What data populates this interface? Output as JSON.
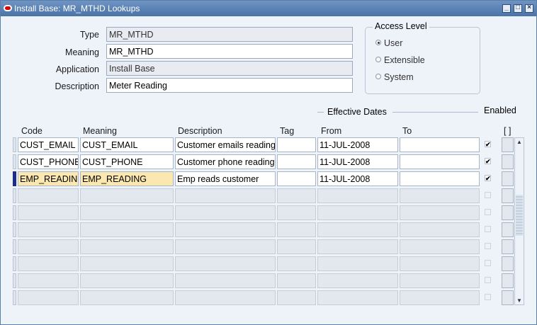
{
  "window": {
    "title": "Install Base: MR_MTHD Lookups",
    "controls": [
      "minimize-icon",
      "maximize-icon",
      "close-icon"
    ]
  },
  "form": {
    "type_label": "Type",
    "type_value": "MR_MTHD",
    "meaning_label": "Meaning",
    "meaning_value": "MR_MTHD",
    "application_label": "Application",
    "application_value": "Install Base",
    "description_label": "Description",
    "description_value": "Meter Reading"
  },
  "access_level": {
    "title": "Access Level",
    "options": [
      "User",
      "Extensible",
      "System"
    ],
    "selected": "User"
  },
  "table": {
    "effective_dates_label": "Effective Dates",
    "enabled_label": "Enabled",
    "flex_label": "[ ]",
    "headers": {
      "code": "Code",
      "meaning": "Meaning",
      "description": "Description",
      "tag": "Tag",
      "from": "From",
      "to": "To"
    },
    "rows": [
      {
        "code": "CUST_EMAIL",
        "meaning": "CUST_EMAIL",
        "description": "Customer emails reading",
        "tag": "",
        "from": "11-JUL-2008",
        "to": "",
        "enabled": true
      },
      {
        "code": "CUST_PHONE",
        "meaning": "CUST_PHONE",
        "description": "Customer phone reading",
        "tag": "",
        "from": "11-JUL-2008",
        "to": "",
        "enabled": true
      },
      {
        "code": "EMP_READING",
        "meaning": "EMP_READING",
        "description": "Emp reads customer",
        "tag": "",
        "from": "11-JUL-2008",
        "to": "",
        "enabled": true
      },
      {
        "code": "",
        "meaning": "",
        "description": "",
        "tag": "",
        "from": "",
        "to": "",
        "enabled": false
      },
      {
        "code": "",
        "meaning": "",
        "description": "",
        "tag": "",
        "from": "",
        "to": "",
        "enabled": false
      },
      {
        "code": "",
        "meaning": "",
        "description": "",
        "tag": "",
        "from": "",
        "to": "",
        "enabled": false
      },
      {
        "code": "",
        "meaning": "",
        "description": "",
        "tag": "",
        "from": "",
        "to": "",
        "enabled": false
      },
      {
        "code": "",
        "meaning": "",
        "description": "",
        "tag": "",
        "from": "",
        "to": "",
        "enabled": false
      },
      {
        "code": "",
        "meaning": "",
        "description": "",
        "tag": "",
        "from": "",
        "to": "",
        "enabled": false
      },
      {
        "code": "",
        "meaning": "",
        "description": "",
        "tag": "",
        "from": "",
        "to": "",
        "enabled": false
      }
    ],
    "current_row": 3
  },
  "colors": {
    "title_bar": "#4b73a6",
    "form_bg": "#eef2f9",
    "current_row_highlight": "#fbe8b0",
    "current_row_indicator": "#1c2d8a"
  }
}
